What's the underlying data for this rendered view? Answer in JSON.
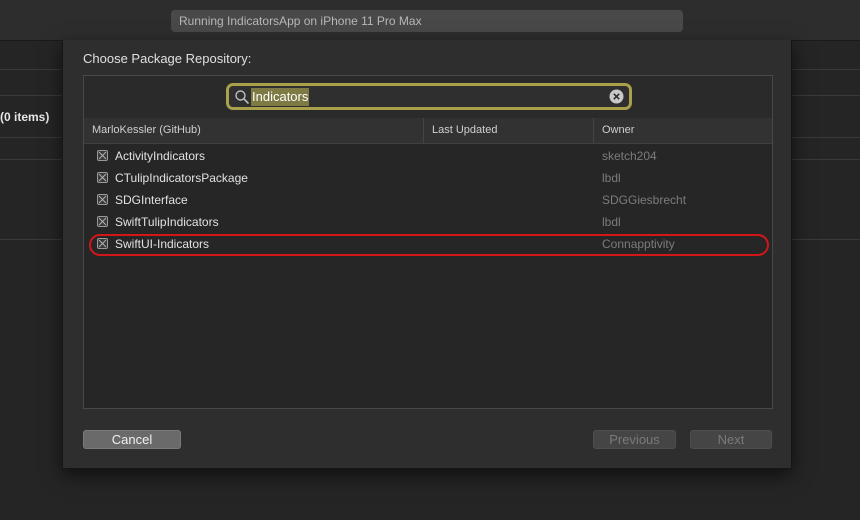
{
  "toolbar": {
    "status": "Running IndicatorsApp on iPhone 11 Pro Max"
  },
  "background": {
    "items_count": "(0 items)"
  },
  "sheet": {
    "title": "Choose Package Repository:",
    "search": {
      "value": "Indicators",
      "icon": "magnifying-glass-icon",
      "clear_icon": "clear-x-icon"
    },
    "columns": [
      "MarloKessler (GitHub)",
      "Last Updated",
      "Owner"
    ],
    "rows": [
      {
        "name": "ActivityIndicators",
        "last_updated": "",
        "owner": "sketch204",
        "icon": "package-icon"
      },
      {
        "name": "CTulipIndicatorsPackage",
        "last_updated": "",
        "owner": "lbdl",
        "icon": "package-icon"
      },
      {
        "name": "SDGInterface",
        "last_updated": "",
        "owner": "SDGGiesbrecht",
        "icon": "package-icon"
      },
      {
        "name": "SwiftTulipIndicators",
        "last_updated": "",
        "owner": "lbdl",
        "icon": "package-icon"
      },
      {
        "name": "SwiftUI-Indicators",
        "last_updated": "",
        "owner": "Connapptivity",
        "icon": "package-icon",
        "highlighted": true
      }
    ],
    "buttons": {
      "cancel": "Cancel",
      "previous": "Previous",
      "next": "Next"
    },
    "colors": {
      "highlight_ring": "#d2161a",
      "search_focus": "#a8a04a"
    }
  }
}
